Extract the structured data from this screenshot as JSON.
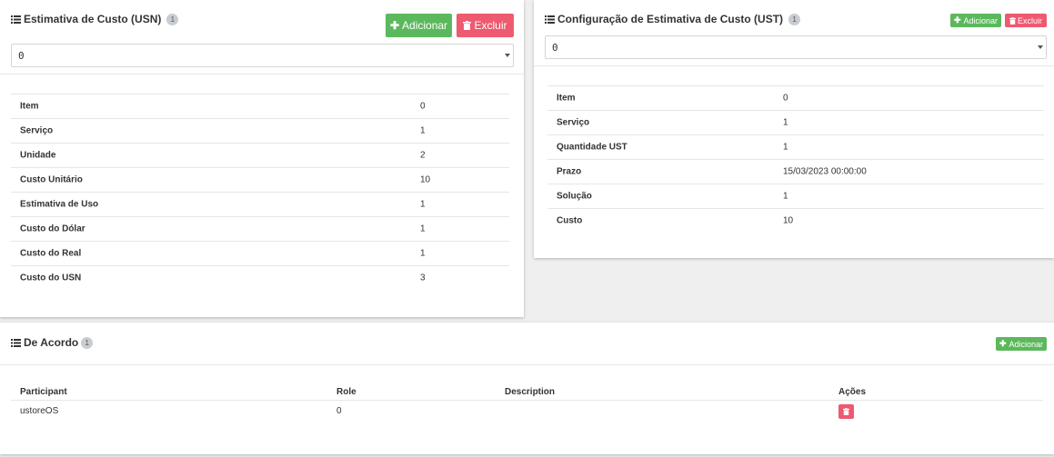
{
  "usn": {
    "title": "Estimativa de Custo (USN)",
    "badge": "1",
    "add_label": "Adicionar",
    "delete_label": "Excluir",
    "select_value": "0",
    "rows": [
      {
        "label": "Item",
        "value": "0"
      },
      {
        "label": "Serviço",
        "value": "1"
      },
      {
        "label": "Unidade",
        "value": "2"
      },
      {
        "label": "Custo Unitário",
        "value": "10"
      },
      {
        "label": "Estimativa de Uso",
        "value": "1"
      },
      {
        "label": "Custo do Dólar",
        "value": "1"
      },
      {
        "label": "Custo do Real",
        "value": "1"
      },
      {
        "label": "Custo do USN",
        "value": "3"
      }
    ]
  },
  "ust": {
    "title": "Configuração de Estimativa de Custo (UST)",
    "badge": "1",
    "add_label": "Adicionar",
    "delete_label": "Excluir",
    "select_value": "0",
    "rows": [
      {
        "label": "Item",
        "value": "0"
      },
      {
        "label": "Serviço",
        "value": "1"
      },
      {
        "label": "Quantidade UST",
        "value": "1"
      },
      {
        "label": "Prazo",
        "value": "15/03/2023 00:00:00"
      },
      {
        "label": "Solução",
        "value": "1"
      },
      {
        "label": "Custo",
        "value": "10"
      }
    ]
  },
  "acordo": {
    "title": "De Acordo",
    "badge": "1",
    "add_label": "Adicionar",
    "columns": [
      "Participant",
      "Role",
      "Description",
      "Ações"
    ],
    "rows": [
      {
        "participant": "ustoreOS",
        "role": "0",
        "description": ""
      }
    ]
  },
  "colors": {
    "success": "#5cb85c",
    "danger": "#ee5a6f",
    "badge": "#c9cdd1"
  },
  "icons": {
    "list": "list-icon",
    "plus": "plus-icon",
    "trash": "trash-icon",
    "caret": "chevron-down-icon"
  }
}
